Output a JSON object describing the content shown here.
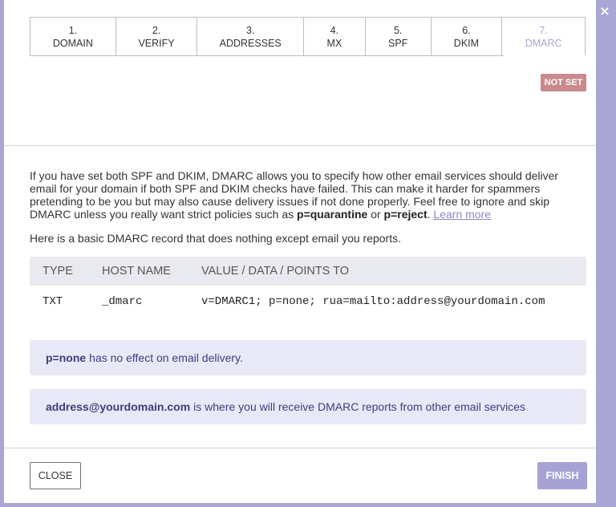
{
  "steps": [
    {
      "num": "1.",
      "label": "DOMAIN"
    },
    {
      "num": "2.",
      "label": "VERIFY"
    },
    {
      "num": "3.",
      "label": "ADDRESSES"
    },
    {
      "num": "4.",
      "label": "MX"
    },
    {
      "num": "5.",
      "label": "SPF"
    },
    {
      "num": "6.",
      "label": "DKIM"
    },
    {
      "num": "7.",
      "label": "DMARC"
    }
  ],
  "active_step": "DMARC",
  "status_badge": "NOT SET",
  "close_icon": "×",
  "intro": {
    "text1": "If you have set both SPF and DKIM, DMARC allows you to specify how other email services should deliver email for your domain if both SPF and DKIM checks have failed. This can make it harder for spammers pretending to be you but may also cause delivery issues if not done properly. Feel free to ignore and skip DMARC unless you really want strict policies such as ",
    "bold1": "p=quarantine",
    "or": " or ",
    "bold2": "p=reject",
    "period": ". ",
    "learn_more": "Learn more"
  },
  "basic_text": "Here is a basic DMARC record that does nothing except email you reports.",
  "table": {
    "headers": [
      "TYPE",
      "HOST NAME",
      "VALUE / DATA / POINTS TO"
    ],
    "row": [
      "TXT",
      "_dmarc",
      "v=DMARC1; p=none; rua=mailto:address@yourdomain.com"
    ]
  },
  "notes": [
    {
      "bold": "p=none",
      "text": "has no effect on email delivery."
    },
    {
      "bold": "address@yourdomain.com",
      "text": "is where you will receive DMARC reports from other email services"
    }
  ],
  "buttons": {
    "close": "CLOSE",
    "finish": "FINISH"
  },
  "colors": {
    "overlay": "#a9a6d3",
    "accent": "#a6a3d4",
    "badge": "#c98a8c",
    "note_bg": "#e9e8f6"
  }
}
